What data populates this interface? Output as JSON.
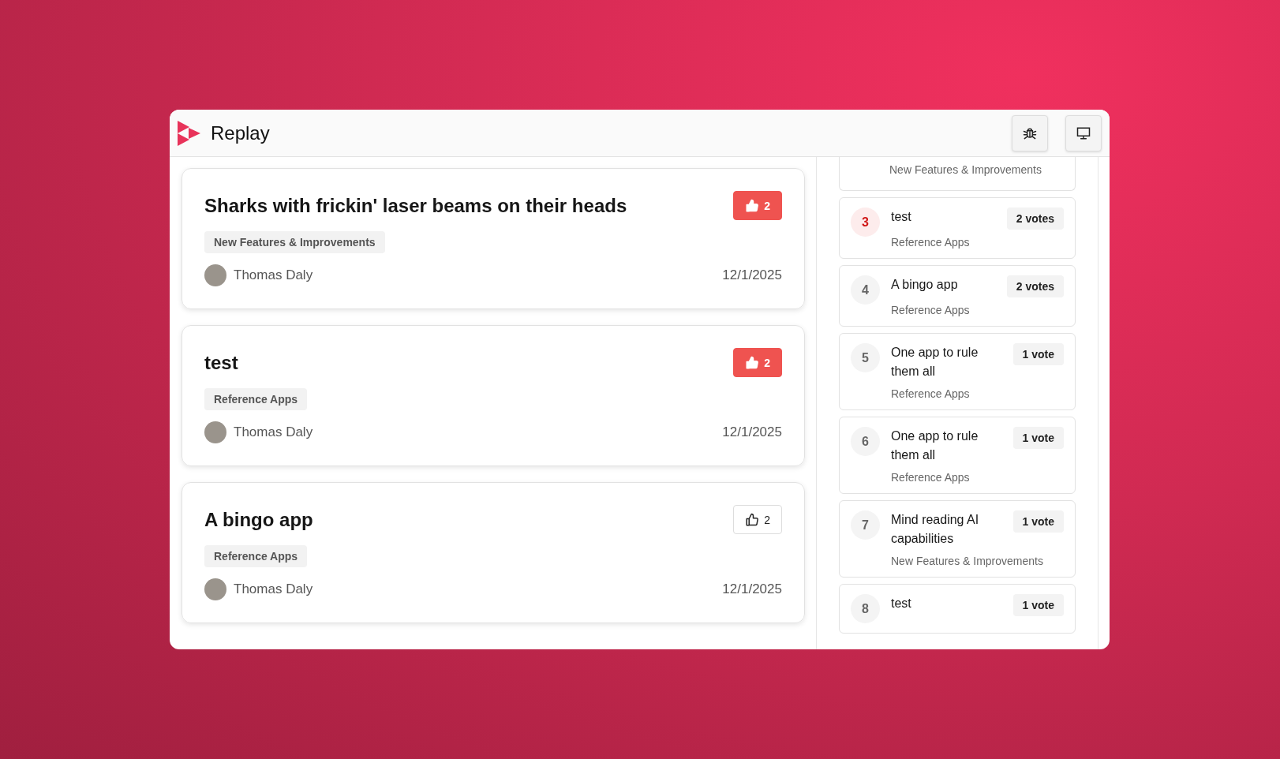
{
  "app": {
    "title": "Replay"
  },
  "toolbar": [
    {
      "kind": "bug"
    },
    {
      "kind": "monitor"
    }
  ],
  "posts": [
    {
      "title": "Sharks with frickin' laser beams on their heads",
      "category": "New Features & Improvements",
      "author": "Thomas Daly",
      "date": "12/1/2025",
      "votes": "2",
      "voted": true
    },
    {
      "title": "test",
      "category": "Reference Apps",
      "author": "Thomas Daly",
      "date": "12/1/2025",
      "votes": "2",
      "voted": true
    },
    {
      "title": "A bingo app",
      "category": "Reference Apps",
      "author": "Thomas Daly",
      "date": "12/1/2025",
      "votes": "2",
      "voted": false
    }
  ],
  "ranking": [
    {
      "category": "New Features & Improvements"
    },
    {
      "rank": "3",
      "title": "test",
      "votes": "2 votes",
      "category": "Reference Apps",
      "highlighted": true
    },
    {
      "rank": "4",
      "title": "A bingo app",
      "votes": "2 votes",
      "category": "Reference Apps",
      "highlighted": false
    },
    {
      "rank": "5",
      "title": "One app to rule them all",
      "votes": "1 vote",
      "category": "Reference Apps",
      "highlighted": false
    },
    {
      "rank": "6",
      "title": "One app to rule them all",
      "votes": "1 vote",
      "category": "Reference Apps",
      "highlighted": false
    },
    {
      "rank": "7",
      "title": "Mind reading AI capabilities",
      "votes": "1 vote",
      "category": "New Features & Improvements",
      "highlighted": false
    },
    {
      "rank": "8",
      "title": "test",
      "votes": "1 vote",
      "highlighted": false
    }
  ]
}
